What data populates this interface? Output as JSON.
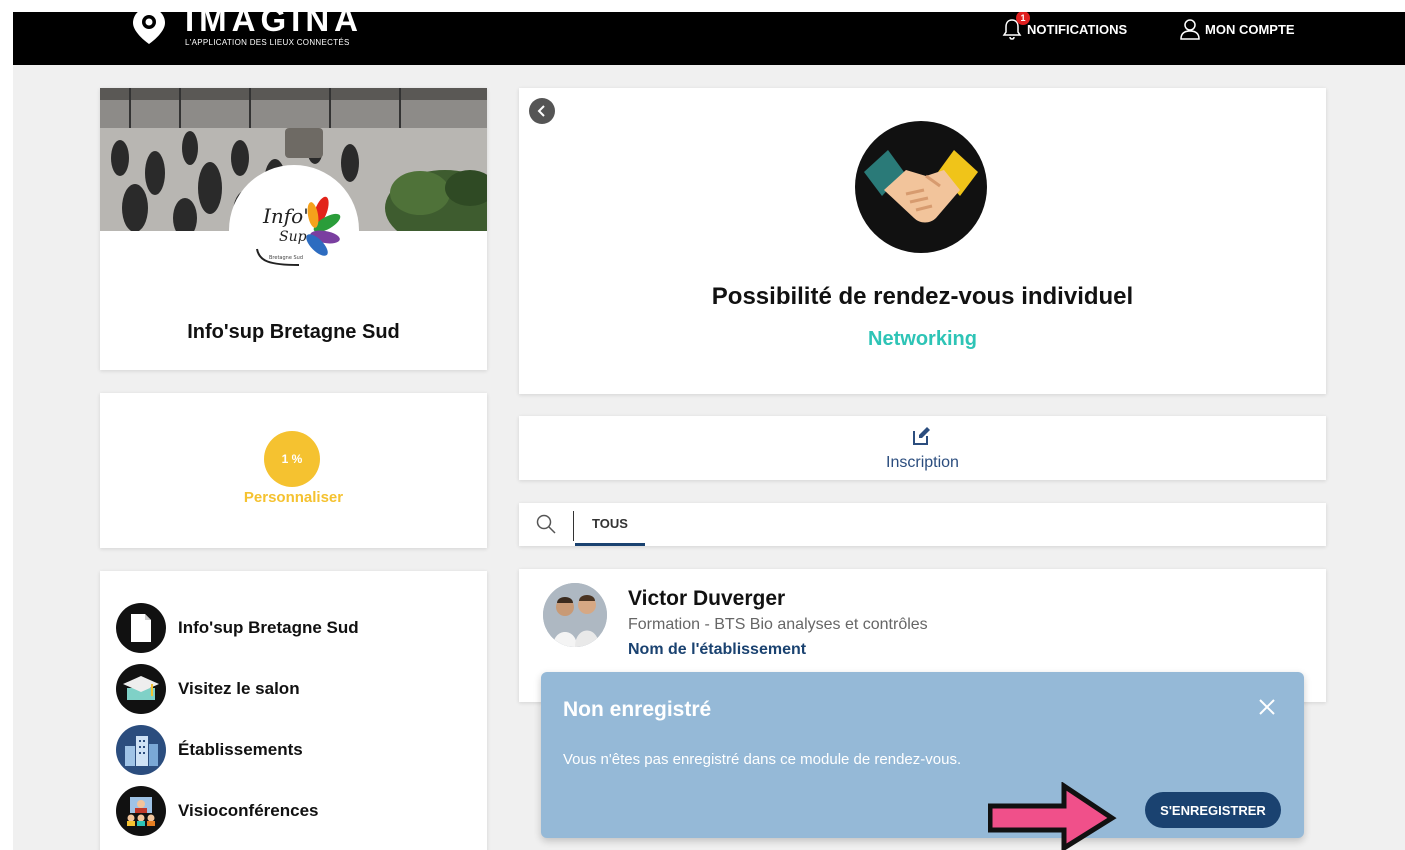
{
  "header": {
    "logo_text": "IMAGINA",
    "logo_subtitle": "L'APPLICATION DES LIEUX CONNECTÉS",
    "notifications_label": "NOTIFICATIONS",
    "notifications_count": "1",
    "account_label": "MON COMPTE"
  },
  "profile": {
    "name": "Info'sup Bretagne Sud",
    "logo_text": "Info'",
    "logo_text2": "Sup",
    "logo_caption": "Bretagne Sud"
  },
  "progress": {
    "percent_label": "1 %",
    "percent_value": 1,
    "action_label": "Personnaliser"
  },
  "menu": {
    "items": [
      {
        "label": "Info'sup Bretagne Sud",
        "icon": "document-icon"
      },
      {
        "label": "Visitez le salon",
        "icon": "graduation-cap-icon"
      },
      {
        "label": "Établissements",
        "icon": "buildings-icon"
      },
      {
        "label": "Visioconférences",
        "icon": "video-conference-icon"
      }
    ]
  },
  "event": {
    "title": "Possibilité de rendez-vous individuel",
    "tag": "Networking",
    "icon": "handshake-icon"
  },
  "inscription": {
    "label": "Inscription"
  },
  "filter": {
    "tab_all": "TOUS"
  },
  "person": {
    "name": "Victor Duverger",
    "formation": "Formation - BTS Bio analyses et contrôles",
    "school": "Nom de l'établissement"
  },
  "modal": {
    "title": "Non enregistré",
    "message": "Vous n'êtes pas enregistré dans ce module de rendez-vous.",
    "button_label": "S'ENREGISTRER"
  },
  "colors": {
    "accent_navy": "#1a4270",
    "accent_teal": "#2ec4b6",
    "accent_yellow": "#f5c230",
    "modal_bg": "#95b9d7",
    "arrow_pink": "#f0508a"
  }
}
